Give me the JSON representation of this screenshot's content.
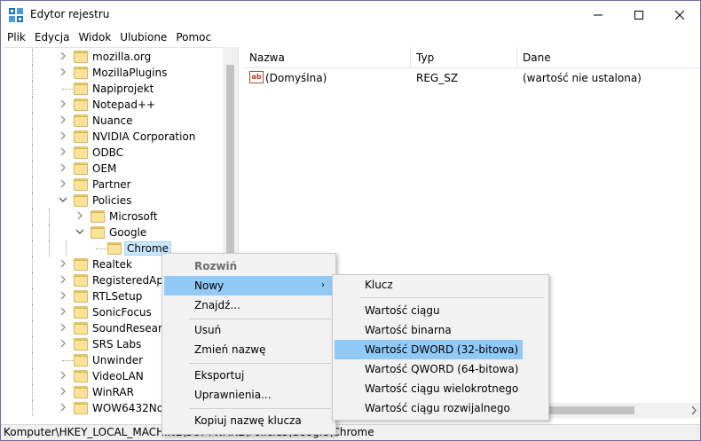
{
  "window": {
    "title": "Edytor rejestru",
    "min_glyph": "—",
    "max_glyph": "☐",
    "close_glyph": "✕"
  },
  "menubar": {
    "items": [
      "Plik",
      "Edycja",
      "Widok",
      "Ulubione",
      "Pomoc"
    ]
  },
  "tree": {
    "items": [
      {
        "label": "mozilla.org"
      },
      {
        "label": "MozillaPlugins"
      },
      {
        "label": "Napiprojekt"
      },
      {
        "label": "Notepad++"
      },
      {
        "label": "Nuance"
      },
      {
        "label": "NVIDIA Corporation"
      },
      {
        "label": "ODBC"
      },
      {
        "label": "OEM"
      },
      {
        "label": "Partner"
      },
      {
        "label": "Policies"
      },
      {
        "label": "Microsoft"
      },
      {
        "label": "Google"
      },
      {
        "label": "Chrome"
      },
      {
        "label": "Realtek"
      },
      {
        "label": "RegisteredApplications"
      },
      {
        "label": "RTLSetup"
      },
      {
        "label": "SonicFocus"
      },
      {
        "label": "SoundResearch"
      },
      {
        "label": "SRS Labs"
      },
      {
        "label": "Unwinder"
      },
      {
        "label": "VideoLAN"
      },
      {
        "label": "WinRAR"
      },
      {
        "label": "WOW6432Node"
      }
    ]
  },
  "list": {
    "columns": [
      "Nazwa",
      "Typ",
      "Dane"
    ],
    "rows": [
      {
        "name": "(Domyślna)",
        "type": "REG_SZ",
        "data": "(wartość nie ustalona)",
        "icon": "string-value-icon"
      }
    ]
  },
  "statusbar": {
    "path": "Komputer\\HKEY_LOCAL_MACHINE\\SOFTWARE\\Policies\\Google\\Chrome"
  },
  "context_menu": {
    "items": [
      "Rozwiń",
      "Nowy",
      "Znajdź...",
      "Usuń",
      "Zmień nazwę",
      "Eksportuj",
      "Uprawnienia...",
      "Kopiuj nazwę klucza"
    ],
    "submenu_arrow": "›"
  },
  "submenu": {
    "items": [
      "Klucz",
      "Wartość ciągu",
      "Wartość binarna",
      "Wartość DWORD (32-bitowa)",
      "Wartość QWORD (64-bitowa)",
      "Wartość ciągu wielokrotnego",
      "Wartość ciągu rozwijalnego"
    ]
  },
  "colors": {
    "highlight": "#91c9f7",
    "selection": "#cce8ff",
    "folder": "#fbe49a"
  }
}
